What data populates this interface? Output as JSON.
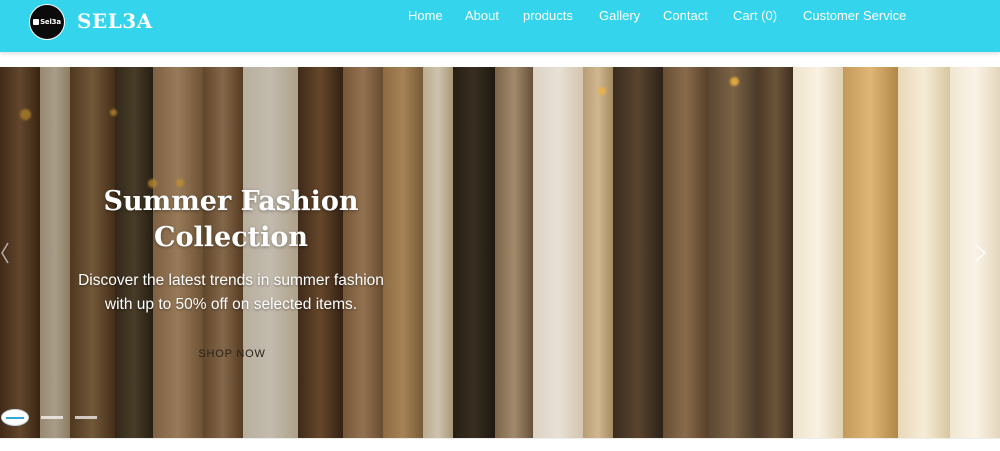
{
  "brand": {
    "logo_text": "Sel3a",
    "name": "SEL3A"
  },
  "nav": {
    "items": [
      {
        "label": "Home"
      },
      {
        "label": "About"
      },
      {
        "label": "products"
      },
      {
        "label": "Gallery"
      },
      {
        "label": "Contact"
      },
      {
        "label": "Cart (0)"
      },
      {
        "label": "Customer Service"
      }
    ]
  },
  "hero": {
    "title_line1": "Summer Fashion",
    "title_line2": "Collection",
    "subtitle_line1": "Discover the latest trends in summer fashion",
    "subtitle_line2": "with up to 50% off on selected items.",
    "cta_label": "SHOP NOW",
    "next_icon": "chevron-right-icon",
    "prev_icon": "chevron-left-icon"
  },
  "carousel": {
    "slide_count": 3,
    "active_index": 0
  },
  "colors": {
    "navbar": "#33d4ec",
    "accent_indicator": "#33a6d8"
  }
}
